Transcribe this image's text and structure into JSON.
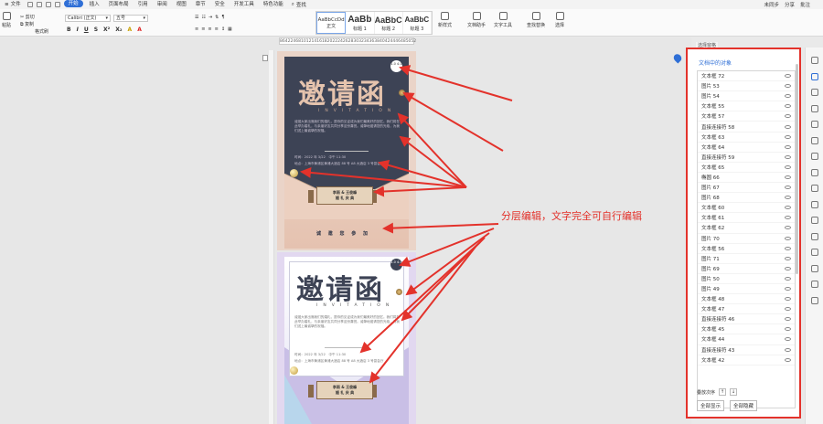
{
  "menubar": {
    "file_label": "文件",
    "items": [
      "开始",
      "插入",
      "页面布局",
      "引用",
      "审阅",
      "视图",
      "章节",
      "安全",
      "开发工具",
      "特色功能"
    ],
    "active_index": 0,
    "search_label": "查找",
    "right": [
      "未同步",
      "分享",
      "批注"
    ]
  },
  "ribbon": {
    "paste": "粘贴",
    "cut": "剪切",
    "copy": "复制",
    "format_painter": "格式刷",
    "font_name": "Calibri (正文)",
    "font_size": "五号",
    "styles": [
      {
        "preview": "AaBbCcDd",
        "label": "正文"
      },
      {
        "preview": "AaBb",
        "label": "标题 1"
      },
      {
        "preview": "AaBbC",
        "label": "标题 2"
      },
      {
        "preview": "AaBbC",
        "label": "标题 3"
      }
    ],
    "new_style": "新样式",
    "doc_helper": "文档助手",
    "text_tools": "文字工具",
    "find_replace": "查找替换",
    "select": "选择",
    "bold": "B",
    "italic": "I",
    "underline": "U"
  },
  "ruler": [
    "8",
    "6",
    "4",
    "2",
    "2",
    "4",
    "6",
    "8",
    "10",
    "12",
    "14",
    "16",
    "18",
    "20",
    "22",
    "24",
    "26",
    "28",
    "30",
    "32",
    "34",
    "36",
    "38",
    "40",
    "42",
    "44",
    "46",
    "48",
    "50",
    "52"
  ],
  "card1": {
    "title": "邀请函",
    "subtitle": "INVITATION",
    "badge": "1.0 4.0",
    "body": "诚邀大家出席我们的婚礼，愿你的见证成为我们最美好的回忆。我们将在此举办婚礼，与亲朋好友共同分享这份喜悦。诚挚地邀请您的光临，为我们送上最诚挚的祝福。",
    "time": "时间：2022 年 3/22　中午 11:30",
    "place": "地点：上海市黄浦区黄浦大酒店 88 号 A8 大酒店 3 号宴会厅",
    "names": "李雨 & 王俊峰",
    "wedding": "婚 礼 庆 典",
    "footer": "诚 邀 您 参 加"
  },
  "card2": {
    "title": "邀请函",
    "subtitle": "INVITATION",
    "badge": "1.0 4.0",
    "body": "诚邀大家出席我们的婚礼，愿你的见证成为我们最美好的回忆。我们将在此举办婚礼，与亲朋好友共同分享这份喜悦。诚挚地邀请您的光临，为我们送上最诚挚的祝福。",
    "time": "时间：2022 年 3/22　中午 11:30",
    "place": "地点：上海市黄浦区黄浦大酒店 88 号 A8 大酒店 3 号宴会厅",
    "names": "李雨 & 王俊峰",
    "wedding": "婚 礼 庆 典"
  },
  "annotation": "分层编辑，文字完全可自行编辑",
  "panel": {
    "header": "选择窗格",
    "title": "文档中的对象",
    "items": [
      "文本框 72",
      "图片 53",
      "图片 54",
      "文本框 55",
      "文本框 57",
      "直接连接符 58",
      "文本框 63",
      "文本框 64",
      "直接连接符 59",
      "文本框 65",
      "椭圆 66",
      "图片 67",
      "图片 68",
      "文本框 60",
      "文本框 61",
      "文本框 62",
      "图片 70",
      "文本框 56",
      "图片 71",
      "图片 69",
      "图片 50",
      "图片 49",
      "文本框 48",
      "文本框 47",
      "直接连接符 46",
      "文本框 45",
      "文本框 44",
      "直接连接符 43",
      "文本框 42"
    ],
    "order_label": "叠放次序",
    "order_up": "↑",
    "order_down": "↓",
    "show_all": "全部显示",
    "hide_all": "全部隐藏"
  },
  "colors": {
    "accent": "#2f6fd6",
    "annotation": "#e3322b",
    "card1_dark": "#3d4355",
    "card1_pink": "#e9c9b6"
  }
}
